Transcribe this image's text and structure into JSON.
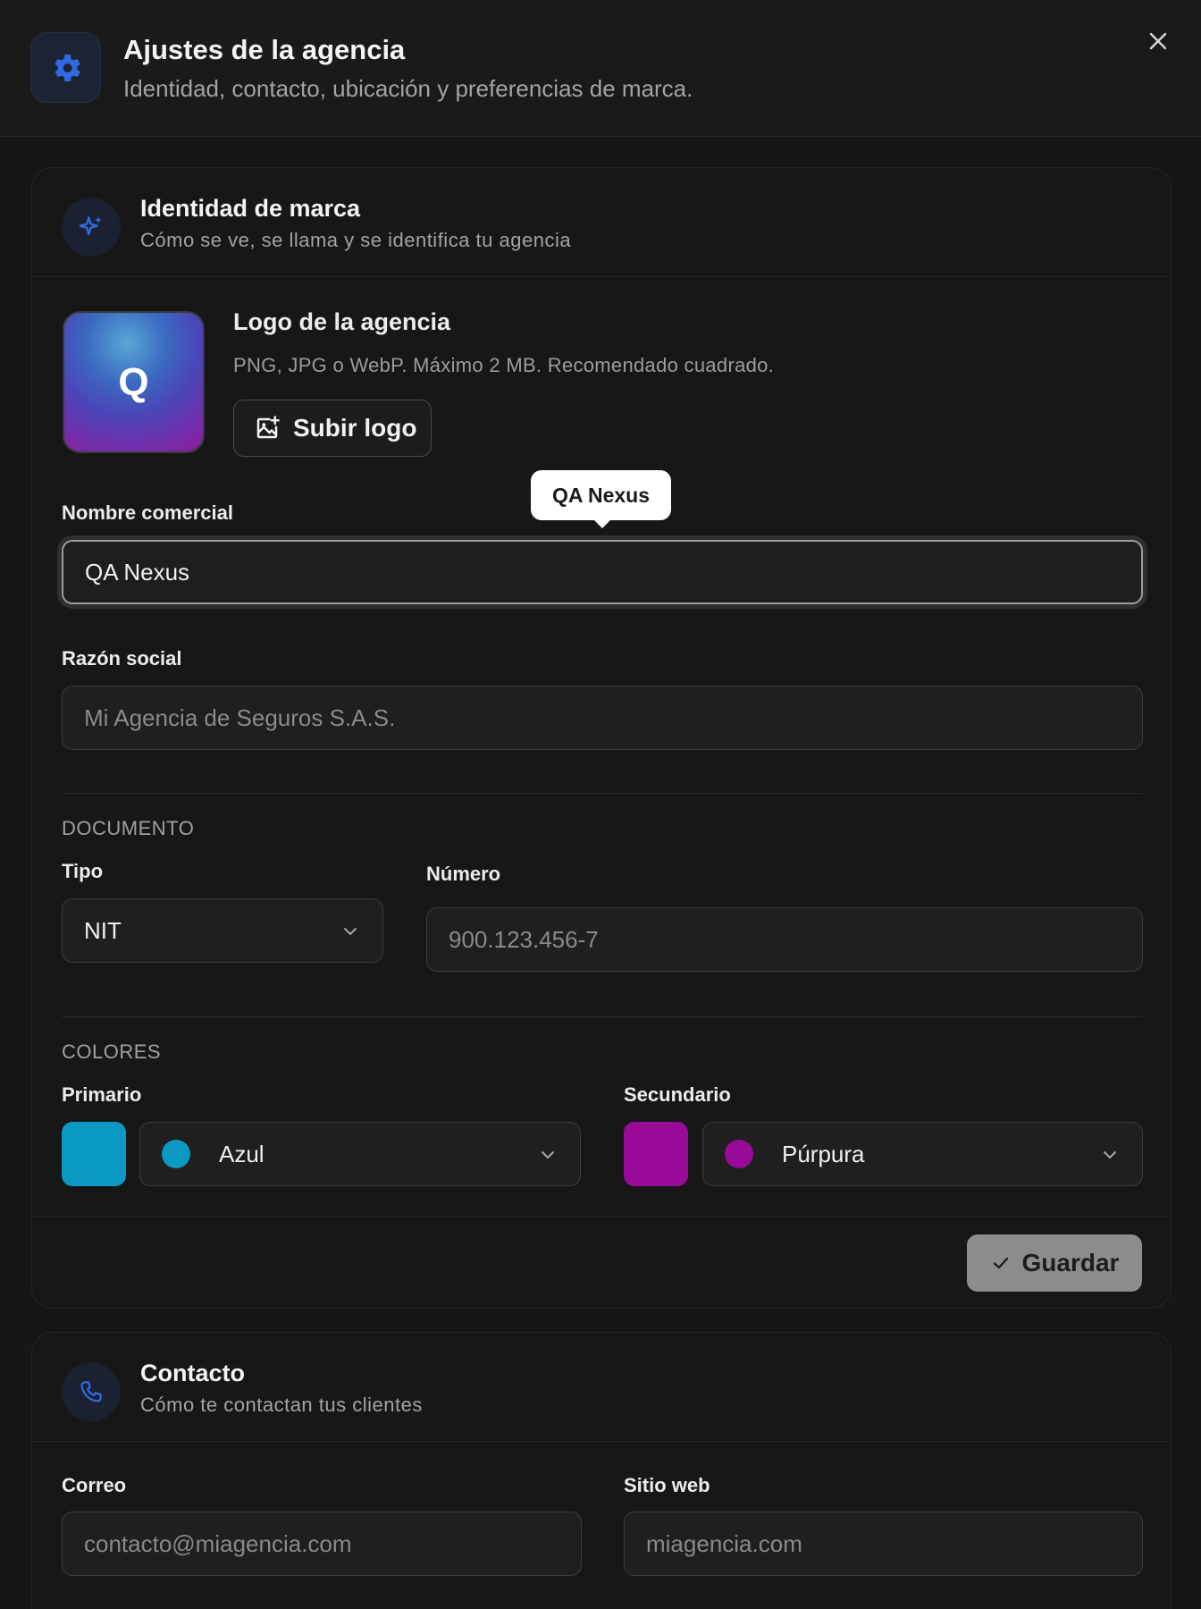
{
  "header": {
    "title": "Ajustes de la agencia",
    "subtitle": "Identidad, contacto, ubicación y preferencias de marca."
  },
  "brand_card": {
    "title": "Identidad de marca",
    "subtitle": "Cómo se ve, se llama y se identifica tu agencia",
    "logo": {
      "letter": "Q",
      "title": "Logo de la agencia",
      "hint": "PNG, JPG o WebP. Máximo 2 MB. Recomendado cuadrado.",
      "upload_label": "Subir logo"
    },
    "trade_name": {
      "label": "Nombre comercial",
      "value": "QA Nexus",
      "tooltip": "QA Nexus"
    },
    "legal_name": {
      "label": "Razón social",
      "placeholder": "Mi Agencia de Seguros S.A.S."
    },
    "document": {
      "section_label": "DOCUMENTO",
      "type_label": "Tipo",
      "type_value": "NIT",
      "number_label": "Número",
      "number_placeholder": "900.123.456-7"
    },
    "colors": {
      "section_label": "COLORES",
      "primary_label": "Primario",
      "primary_value": "Azul",
      "primary_color": "#0b98c2",
      "secondary_label": "Secundario",
      "secondary_value": "Púrpura",
      "secondary_color": "#9a0a98"
    },
    "save_label": "Guardar"
  },
  "contact_card": {
    "title": "Contacto",
    "subtitle": "Cómo te contactan tus clientes",
    "email_label": "Correo",
    "email_placeholder": "contacto@miagencia.com",
    "website_label": "Sitio web",
    "website_placeholder": "miagencia.com"
  },
  "icons": {
    "header": "gear-icon",
    "brand": "sparkles-icon",
    "contact": "phone-icon",
    "upload": "image-plus-icon",
    "save": "check-icon",
    "close": "close-icon"
  },
  "colors": {
    "background": "#161616",
    "accent_icon": "#2f6ae0",
    "save_button": "#8c8c8c"
  }
}
